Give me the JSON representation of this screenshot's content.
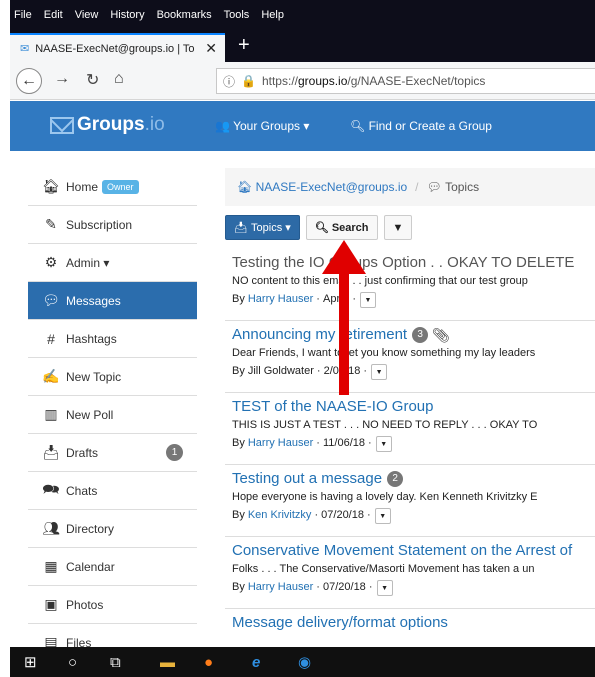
{
  "menubar": [
    "File",
    "Edit",
    "View",
    "History",
    "Bookmarks",
    "Tools",
    "Help"
  ],
  "tab": {
    "title": "NAASE-ExecNet@groups.io | To",
    "close": "✕",
    "new": "+"
  },
  "url": {
    "prefix": "https://",
    "host": "groups.io",
    "path": "/g/NAASE-ExecNet/topics"
  },
  "header": {
    "logo_main": "Groups",
    "logo_io": ".io",
    "your_groups": "Your Groups",
    "find_group": "Find or Create a Group"
  },
  "sidebar": {
    "items": [
      {
        "label": "Home",
        "icon": "home-icon",
        "badge": "Owner"
      },
      {
        "label": "Subscription",
        "icon": "pencil-icon"
      },
      {
        "label": "Admin",
        "icon": "gears-icon",
        "caret": "▾"
      },
      {
        "label": "Messages",
        "icon": "comments-icon",
        "active": true
      },
      {
        "label": "Hashtags",
        "icon": "hashtag-icon"
      },
      {
        "label": "New Topic",
        "icon": "edit-icon"
      },
      {
        "label": "New Poll",
        "icon": "bar-chart-icon"
      },
      {
        "label": "Drafts",
        "icon": "inbox-icon",
        "count": "1"
      },
      {
        "label": "Chats",
        "icon": "chat-icon"
      },
      {
        "label": "Directory",
        "icon": "users-icon"
      },
      {
        "label": "Calendar",
        "icon": "calendar-icon"
      },
      {
        "label": "Photos",
        "icon": "photos-icon"
      },
      {
        "label": "Files",
        "icon": "files-icon"
      }
    ]
  },
  "breadcrumb": {
    "group": "NAASE-ExecNet@groups.io",
    "current": "Topics"
  },
  "toolbar": {
    "topics": "Topics",
    "search": "Search"
  },
  "topics": [
    {
      "title": "Testing the IO Groups Option . . OKAY TO DELETE",
      "snippet": "NO content to this email . . just confirming that our test group",
      "author": "Harry Hauser",
      "date": "Apr 5",
      "read": true
    },
    {
      "title": "Announcing my retirement",
      "count": "3",
      "attachment": true,
      "snippet": "Dear Friends, I want to let you know something my lay leaders",
      "author": "Jill Goldwater",
      "date": "2/05/18",
      "author_plain": true
    },
    {
      "title": "TEST of the NAASE-IO Group",
      "snippet": "THIS IS JUST A TEST . . . NO NEED TO REPLY . . . OKAY TO",
      "author": "Harry Hauser",
      "date": "11/06/18"
    },
    {
      "title": "Testing out a message",
      "count": "2",
      "snippet": "Hope everyone is having a lovely day. Ken Kenneth Krivitzky E",
      "author": "Ken Krivitzky",
      "date": "07/20/18"
    },
    {
      "title": "Conservative Movement Statement on the Arrest of",
      "snippet": "Folks . . . The Conservative/Masorti Movement has taken a un",
      "author": "Harry Hauser",
      "date": "07/20/18"
    },
    {
      "title": "Message delivery/format options",
      "snippet": "",
      "author": "",
      "date": ""
    }
  ],
  "colors": {
    "header": "#3079c1",
    "active": "#2b6dad",
    "link": "#2271b3",
    "arrow": "#e00000"
  }
}
